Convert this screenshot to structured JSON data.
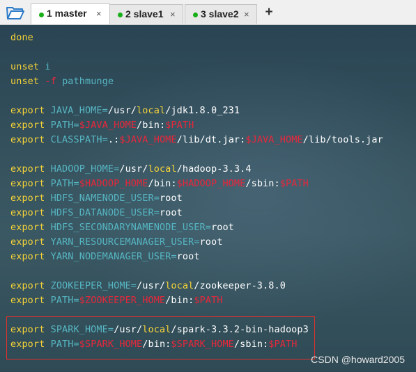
{
  "tabs": [
    {
      "label": "1 master",
      "close": "×",
      "active": true
    },
    {
      "label": "2 slave1",
      "close": "×",
      "active": false
    },
    {
      "label": "3 slave2",
      "close": "×",
      "active": false
    }
  ],
  "new_tab_label": "+",
  "colors": {
    "keyword": "#f7d437",
    "variable": "#56b6c2",
    "substitution": "#e8273b",
    "plain": "#ffffff",
    "status_dot": "#18b018",
    "highlight_box": "#e0302d"
  },
  "terminal_lines": [
    [
      {
        "t": "done",
        "c": "kw"
      }
    ],
    [],
    [
      {
        "t": "unset ",
        "c": "kw"
      },
      {
        "t": "i",
        "c": "var"
      }
    ],
    [
      {
        "t": "unset ",
        "c": "kw"
      },
      {
        "t": "-f ",
        "c": "sym"
      },
      {
        "t": "pathmunge",
        "c": "var"
      }
    ],
    [],
    [
      {
        "t": "export ",
        "c": "kw"
      },
      {
        "t": "JAVA_HOME",
        "c": "var"
      },
      {
        "t": "=",
        "c": "eq"
      },
      {
        "t": "/usr/",
        "c": "val"
      },
      {
        "t": "local",
        "c": "loc"
      },
      {
        "t": "/jdk1.8.0_231",
        "c": "val"
      }
    ],
    [
      {
        "t": "export ",
        "c": "kw"
      },
      {
        "t": "PATH",
        "c": "var"
      },
      {
        "t": "=",
        "c": "eq"
      },
      {
        "t": "$JAVA_HOME",
        "c": "sym"
      },
      {
        "t": "/bin:",
        "c": "val"
      },
      {
        "t": "$PATH",
        "c": "sym"
      }
    ],
    [
      {
        "t": "export ",
        "c": "kw"
      },
      {
        "t": "CLASSPATH",
        "c": "var"
      },
      {
        "t": "=",
        "c": "eq"
      },
      {
        "t": ".:",
        "c": "val"
      },
      {
        "t": "$JAVA_HOME",
        "c": "sym"
      },
      {
        "t": "/lib/dt.jar:",
        "c": "val"
      },
      {
        "t": "$JAVA_HOME",
        "c": "sym"
      },
      {
        "t": "/lib/tools.jar",
        "c": "val"
      }
    ],
    [],
    [
      {
        "t": "export ",
        "c": "kw"
      },
      {
        "t": "HADOOP_HOME",
        "c": "var"
      },
      {
        "t": "=",
        "c": "eq"
      },
      {
        "t": "/usr/",
        "c": "val"
      },
      {
        "t": "local",
        "c": "loc"
      },
      {
        "t": "/hadoop-3.3.4",
        "c": "val"
      }
    ],
    [
      {
        "t": "export ",
        "c": "kw"
      },
      {
        "t": "PATH",
        "c": "var"
      },
      {
        "t": "=",
        "c": "eq"
      },
      {
        "t": "$HADOOP_HOME",
        "c": "sym"
      },
      {
        "t": "/bin:",
        "c": "val"
      },
      {
        "t": "$HADOOP_HOME",
        "c": "sym"
      },
      {
        "t": "/sbin:",
        "c": "val"
      },
      {
        "t": "$PATH",
        "c": "sym"
      }
    ],
    [
      {
        "t": "export ",
        "c": "kw"
      },
      {
        "t": "HDFS_NAMENODE_USER",
        "c": "var"
      },
      {
        "t": "=",
        "c": "eq"
      },
      {
        "t": "root",
        "c": "val"
      }
    ],
    [
      {
        "t": "export ",
        "c": "kw"
      },
      {
        "t": "HDFS_DATANODE_USER",
        "c": "var"
      },
      {
        "t": "=",
        "c": "eq"
      },
      {
        "t": "root",
        "c": "val"
      }
    ],
    [
      {
        "t": "export ",
        "c": "kw"
      },
      {
        "t": "HDFS_SECONDARYNAMENODE_USER",
        "c": "var"
      },
      {
        "t": "=",
        "c": "eq"
      },
      {
        "t": "root",
        "c": "val"
      }
    ],
    [
      {
        "t": "export ",
        "c": "kw"
      },
      {
        "t": "YARN_RESOURCEMANAGER_USER",
        "c": "var"
      },
      {
        "t": "=",
        "c": "eq"
      },
      {
        "t": "root",
        "c": "val"
      }
    ],
    [
      {
        "t": "export ",
        "c": "kw"
      },
      {
        "t": "YARN_NODEMANAGER_USER",
        "c": "var"
      },
      {
        "t": "=",
        "c": "eq"
      },
      {
        "t": "root",
        "c": "val"
      }
    ],
    [],
    [
      {
        "t": "export ",
        "c": "kw"
      },
      {
        "t": "ZOOKEEPER_HOME",
        "c": "var"
      },
      {
        "t": "=",
        "c": "eq"
      },
      {
        "t": "/usr/",
        "c": "val"
      },
      {
        "t": "local",
        "c": "loc"
      },
      {
        "t": "/zookeeper-3.8.0",
        "c": "val"
      }
    ],
    [
      {
        "t": "export ",
        "c": "kw"
      },
      {
        "t": "PATH",
        "c": "var"
      },
      {
        "t": "=",
        "c": "eq"
      },
      {
        "t": "$ZOOKEEPER_HOME",
        "c": "sym"
      },
      {
        "t": "/bin:",
        "c": "val"
      },
      {
        "t": "$PATH",
        "c": "sym"
      }
    ],
    [],
    [
      {
        "t": "export ",
        "c": "kw"
      },
      {
        "t": "SPARK_HOME",
        "c": "var"
      },
      {
        "t": "=",
        "c": "eq"
      },
      {
        "t": "/usr/",
        "c": "val"
      },
      {
        "t": "local",
        "c": "loc"
      },
      {
        "t": "/spark-3.3.2-bin-hadoop3",
        "c": "val"
      }
    ],
    [
      {
        "t": "export ",
        "c": "kw"
      },
      {
        "t": "PATH",
        "c": "var"
      },
      {
        "t": "=",
        "c": "eq"
      },
      {
        "t": "$SPARK_HOME",
        "c": "sym"
      },
      {
        "t": "/bin:",
        "c": "val"
      },
      {
        "t": "$SPARK_HOME",
        "c": "sym"
      },
      {
        "t": "/sbin:",
        "c": "val"
      },
      {
        "t": "$PATH",
        "c": "sym"
      }
    ]
  ],
  "watermark": "CSDN @howard2005"
}
